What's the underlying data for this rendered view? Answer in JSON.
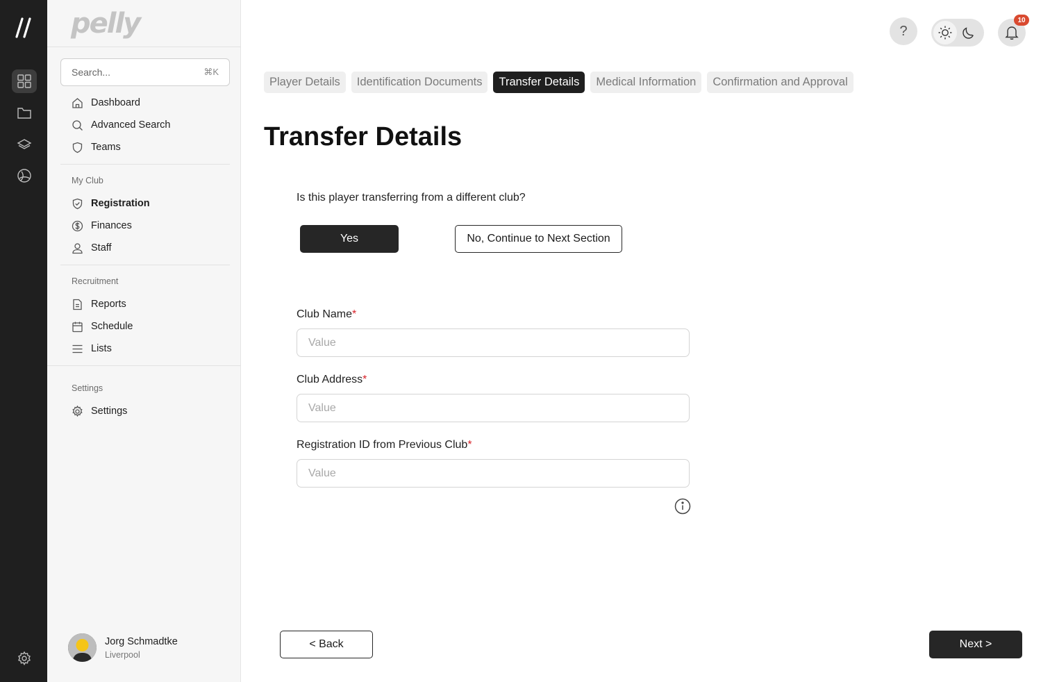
{
  "app": {
    "brand": "pelly"
  },
  "rail": {
    "items": [
      {
        "icon": "grid-icon",
        "active": true
      },
      {
        "icon": "folder-icon",
        "active": false
      },
      {
        "icon": "layers-icon",
        "active": false
      },
      {
        "icon": "globe-icon",
        "active": false
      }
    ],
    "bottom_icon": "settings-gear-icon"
  },
  "search": {
    "placeholder": "Search...",
    "shortcut": "⌘K"
  },
  "sidebar": {
    "main": [
      {
        "label": "Dashboard",
        "icon": "home-icon"
      },
      {
        "label": "Advanced Search",
        "icon": "search-icon"
      },
      {
        "label": "Teams",
        "icon": "shield-icon"
      }
    ],
    "my_club": {
      "title": "My Club",
      "items": [
        {
          "label": "Registration",
          "icon": "shield-check-icon",
          "active": true
        },
        {
          "label": "Finances",
          "icon": "dollar-circle-icon"
        },
        {
          "label": "Staff",
          "icon": "user-icon"
        }
      ]
    },
    "recruitment": {
      "title": "Recruitment",
      "items": [
        {
          "label": "Reports",
          "icon": "document-icon"
        },
        {
          "label": "Schedule",
          "icon": "calendar-icon"
        },
        {
          "label": "Lists",
          "icon": "list-icon"
        }
      ]
    },
    "settings": {
      "title": "Settings",
      "items": [
        {
          "label": "Settings",
          "icon": "gear-icon"
        }
      ]
    }
  },
  "user": {
    "name": "Jorg Schmadtke",
    "club": "Liverpool"
  },
  "header": {
    "help": "?",
    "notifications_count": "10"
  },
  "steps": [
    {
      "label": "Player Details",
      "active": false
    },
    {
      "label": "Identification Documents",
      "active": false
    },
    {
      "label": "Transfer Details",
      "active": true
    },
    {
      "label": "Medical Information",
      "active": false
    },
    {
      "label": "Confirmation and Approval",
      "active": false
    }
  ],
  "page": {
    "title": "Transfer Details"
  },
  "question": {
    "text": "Is this player transferring from a different club?",
    "yes_label": "Yes",
    "no_label": "No, Continue to Next Section"
  },
  "form": {
    "required_mark": "*",
    "fields": [
      {
        "label": "Club Name",
        "placeholder": "Value",
        "value": ""
      },
      {
        "label": "Club Address",
        "placeholder": "Value",
        "value": ""
      },
      {
        "label": "Registration ID from Previous Club",
        "placeholder": "Value",
        "value": ""
      }
    ]
  },
  "footer": {
    "back_label": "< Back",
    "next_label": "Next >"
  },
  "colors": {
    "dark": "#1f1f1f",
    "required": "#d8232a",
    "badge": "#d94a30"
  }
}
